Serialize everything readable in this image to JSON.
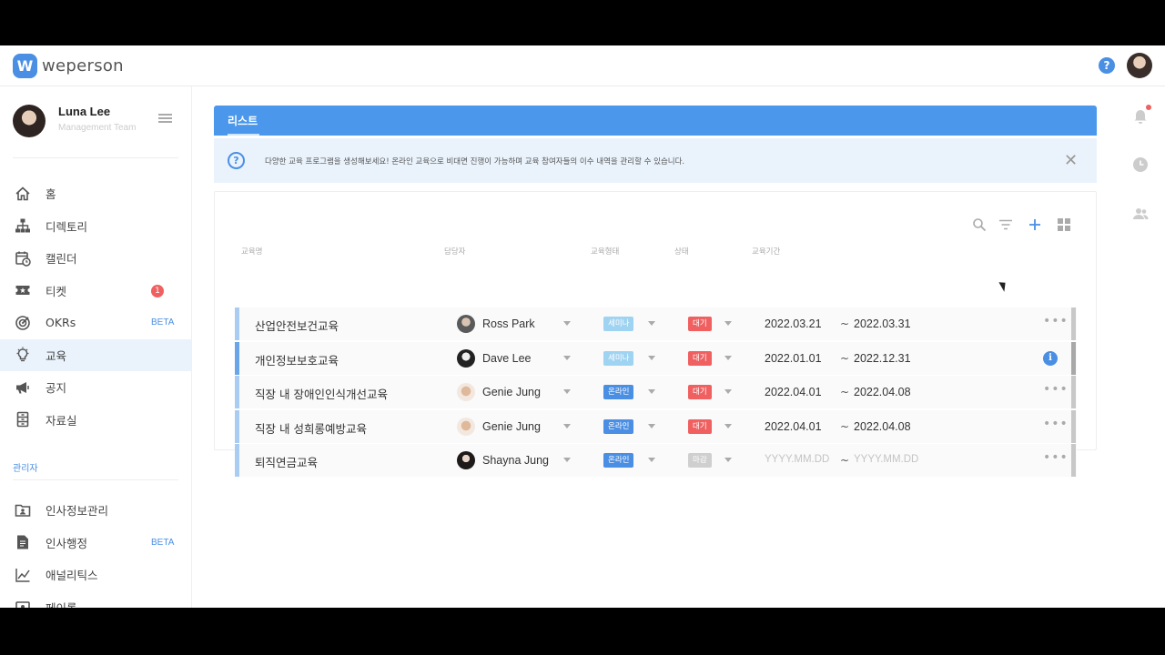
{
  "app": {
    "logo_mark": "W",
    "logo_text": "weperson"
  },
  "topbar": {
    "help_icon": "?"
  },
  "profile": {
    "name": "Luna Lee",
    "team": "Management Team"
  },
  "sidebar": {
    "items": [
      {
        "label": "홈",
        "icon": "home-icon"
      },
      {
        "label": "디렉토리",
        "icon": "org-chart-icon"
      },
      {
        "label": "캘린더",
        "icon": "calendar-icon"
      },
      {
        "label": "티켓",
        "icon": "ticket-icon",
        "badge": "1"
      },
      {
        "label": "OKRs",
        "icon": "target-icon",
        "beta": "BETA"
      },
      {
        "label": "교육",
        "icon": "lightbulb-icon",
        "active": true
      },
      {
        "label": "공지",
        "icon": "megaphone-icon"
      },
      {
        "label": "자료실",
        "icon": "archive-icon"
      }
    ],
    "admin_label": "관리자",
    "admin_items": [
      {
        "label": "인사정보관리",
        "icon": "id-card-icon"
      },
      {
        "label": "인사행정",
        "icon": "document-icon",
        "beta": "BETA"
      },
      {
        "label": "애널리틱스",
        "icon": "analytics-icon"
      },
      {
        "label": "페이롤",
        "icon": "payroll-icon"
      }
    ]
  },
  "main": {
    "tab_label": "리스트",
    "info_text": "다양한 교육 프로그램을 생성해보세요! 온라인 교육으로 비대면 진행이 가능하며 교육 참여자들의 이수 내역을 관리할 수 있습니다.",
    "info_close": "✕",
    "columns": [
      "교육명",
      "담당자",
      "교육형태",
      "상태",
      "교육기간"
    ],
    "rows": [
      {
        "title": "산업안전보건교육",
        "manager": "Ross Park",
        "type": "세미나",
        "type_color": "#9fd3f2",
        "status": "대기",
        "status_color": "#f06060",
        "start": "2022.03.21",
        "end": "2022.03.31",
        "placeholder": false,
        "action": "more"
      },
      {
        "title": "개인정보보호교육",
        "manager": "Dave Lee",
        "type": "세미나",
        "type_color": "#9fd3f2",
        "status": "대기",
        "status_color": "#f06060",
        "start": "2022.01.01",
        "end": "2022.12.31",
        "placeholder": false,
        "action": "info"
      },
      {
        "title": "직장 내 장애인인식개선교육",
        "manager": "Genie Jung",
        "type": "온라인",
        "type_color": "#4a8fe3",
        "status": "대기",
        "status_color": "#f06060",
        "start": "2022.04.01",
        "end": "2022.04.08",
        "placeholder": false,
        "action": "more"
      },
      {
        "title": "직장 내 성희롱예방교육",
        "manager": "Genie Jung",
        "type": "온라인",
        "type_color": "#4a8fe3",
        "status": "대기",
        "status_color": "#f06060",
        "start": "2022.04.01",
        "end": "2022.04.08",
        "placeholder": false,
        "action": "more"
      },
      {
        "title": "퇴직연금교육",
        "manager": "Shayna Jung",
        "type": "온라인",
        "type_color": "#4a8fe3",
        "status": "마감",
        "status_color": "#cfcfcf",
        "start": "YYYY.MM.DD",
        "end": "YYYY.MM.DD",
        "placeholder": true,
        "action": "more"
      }
    ],
    "tilde": "~",
    "more_symbol": "•••",
    "info_symbol": "i"
  }
}
